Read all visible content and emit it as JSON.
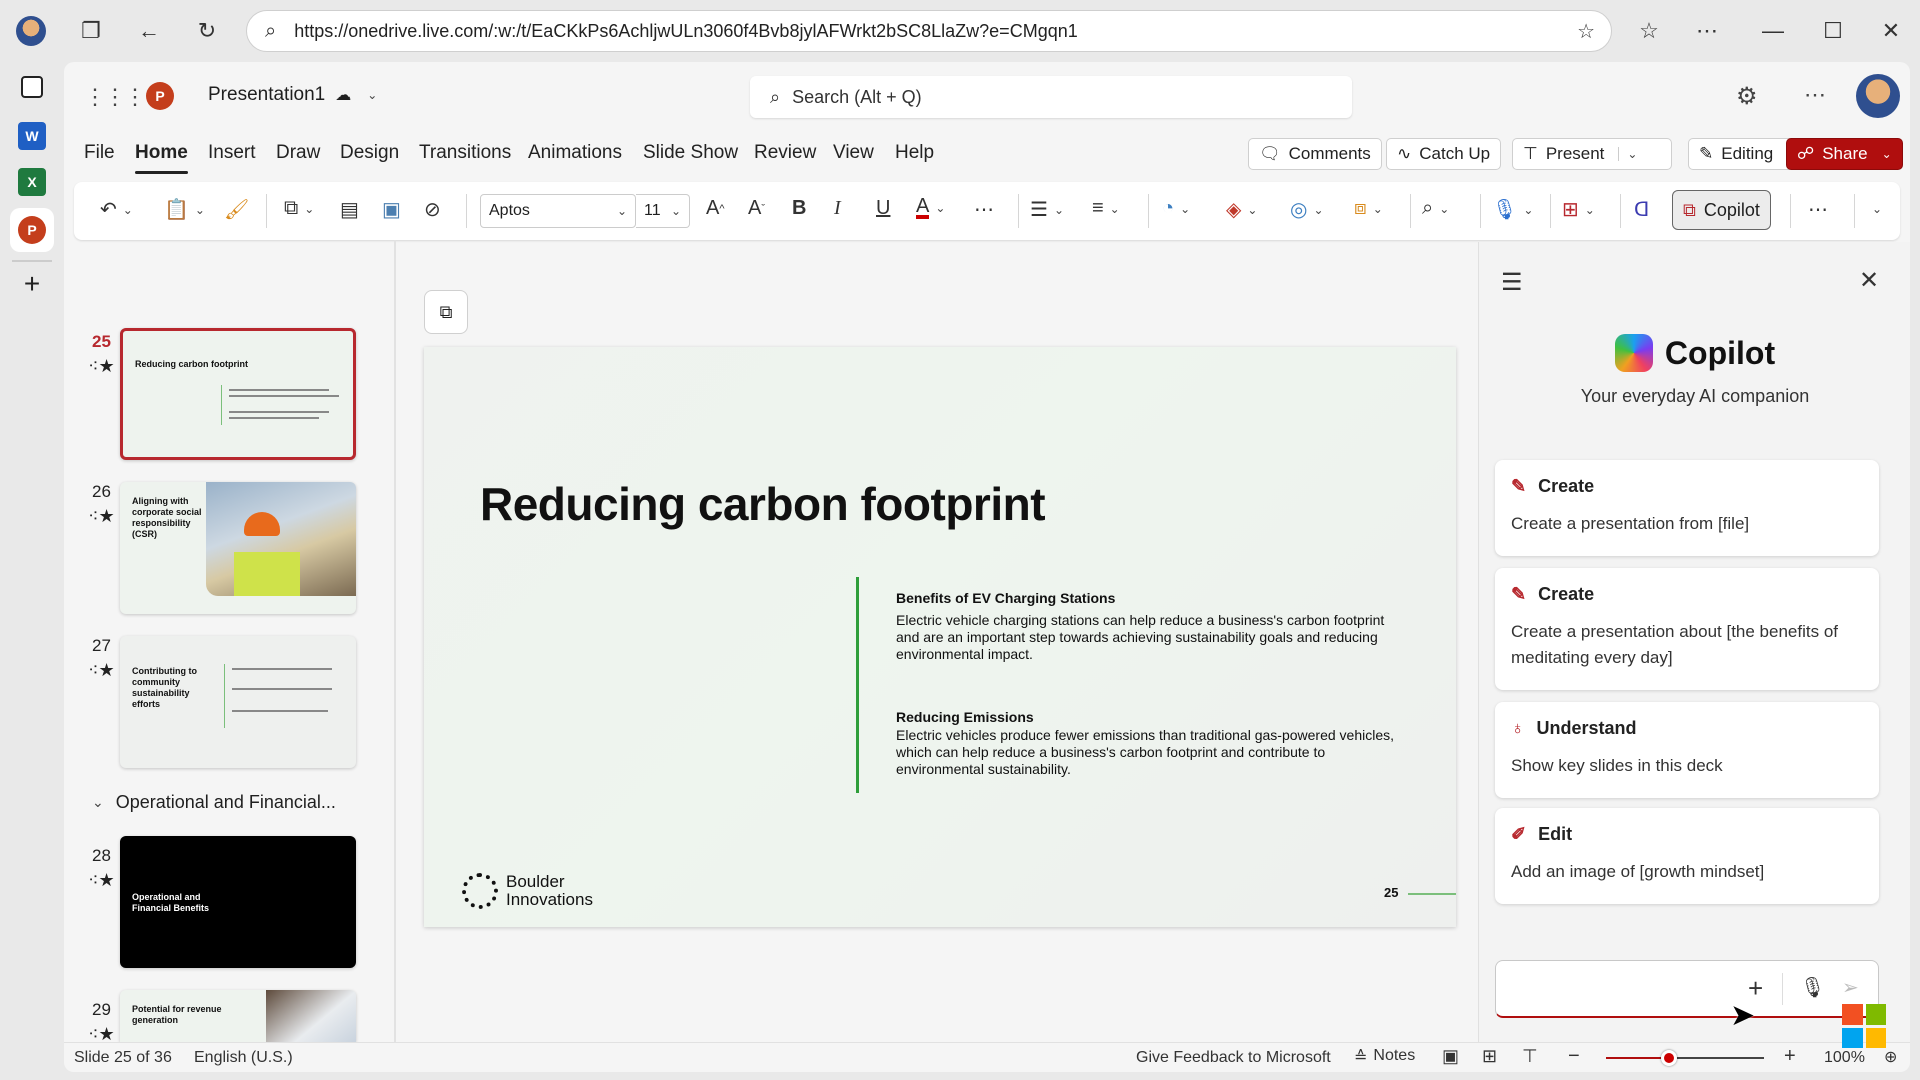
{
  "browser": {
    "url": "https://onedrive.live.com/:w:/t/EaCKkPs6AchljwULn3060f4Bvb8jylAFWrkt2bSC8LlaZw?e=CMgqn1",
    "icons": [
      "profile-avatar",
      "tab-actions-icon",
      "back-icon",
      "refresh-icon",
      "search-icon",
      "add-favorite-icon",
      "favorites-icon",
      "more-icon",
      "minimize-icon",
      "maximize-icon",
      "close-icon"
    ]
  },
  "rail": {
    "apps": [
      "sidebar-panel",
      "Word",
      "Excel",
      "PowerPoint",
      "add"
    ]
  },
  "app": {
    "doc_title": "Presentation1",
    "search_placeholder": "Search (Alt + Q)",
    "tabs": [
      "File",
      "Home",
      "Insert",
      "Draw",
      "Design",
      "Transitions",
      "Animations",
      "Slide Show",
      "Review",
      "View",
      "Help"
    ],
    "active_tab": "Home",
    "actions": {
      "comments": "Comments",
      "catch_up": "Catch Up",
      "present": "Present",
      "editing": "Editing",
      "share": "Share"
    },
    "ribbon": {
      "font_name": "Aptos",
      "font_size": "11",
      "copilot": "Copilot"
    }
  },
  "thumbnails": {
    "slides": [
      {
        "num": "25",
        "title": "Reducing carbon footprint",
        "style": "light",
        "selected": true
      },
      {
        "num": "26",
        "title": "Aligning with corporate social responsibility (CSR)",
        "style": "image",
        "selected": false
      },
      {
        "num": "27",
        "title": "Contributing to community sustainability efforts",
        "style": "light",
        "selected": false
      },
      {
        "num": "28",
        "title": "Operational and Financial Benefits",
        "style": "dark",
        "selected": false
      },
      {
        "num": "29",
        "title": "Potential for revenue generation",
        "style": "image",
        "selected": false
      }
    ],
    "section": "Operational and Financial..."
  },
  "slide": {
    "title": "Reducing carbon footprint",
    "sections": [
      {
        "heading": "Benefits of EV Charging Stations",
        "body": "Electric vehicle charging stations can help reduce a business's carbon footprint and are an important step towards achieving sustainability goals and reducing environmental impact."
      },
      {
        "heading": "Reducing Emissions",
        "body": "Electric vehicles produce fewer emissions than traditional gas-powered vehicles, which can help reduce a business's carbon footprint and contribute to environmental sustainability."
      }
    ],
    "logo_line1": "Boulder",
    "logo_line2": "Innovations",
    "page_number": "25",
    "accent": "#2e9e3a"
  },
  "copilot": {
    "title": "Copilot",
    "subtitle": "Your everyday AI companion",
    "cards": [
      {
        "icon": "create-icon",
        "heading": "Create",
        "body": "Create a presentation from [file]"
      },
      {
        "icon": "create-icon",
        "heading": "Create",
        "body": "Create a presentation about [the benefits of meditating every day]"
      },
      {
        "icon": "lightbulb-icon",
        "heading": "Understand",
        "body": "Show key slides in this deck"
      },
      {
        "icon": "edit-icon",
        "heading": "Edit",
        "body": "Add an image of [growth mindset]"
      }
    ],
    "input_placeholder": ""
  },
  "status": {
    "slide_info": "Slide 25 of 36",
    "language": "English (U.S.)",
    "feedback": "Give Feedback to Microsoft",
    "notes": "Notes",
    "zoom": "100%",
    "zoom_level": 0.4
  },
  "colors": {
    "brand": "#b7282e",
    "share_bg": "#b00e0e"
  }
}
